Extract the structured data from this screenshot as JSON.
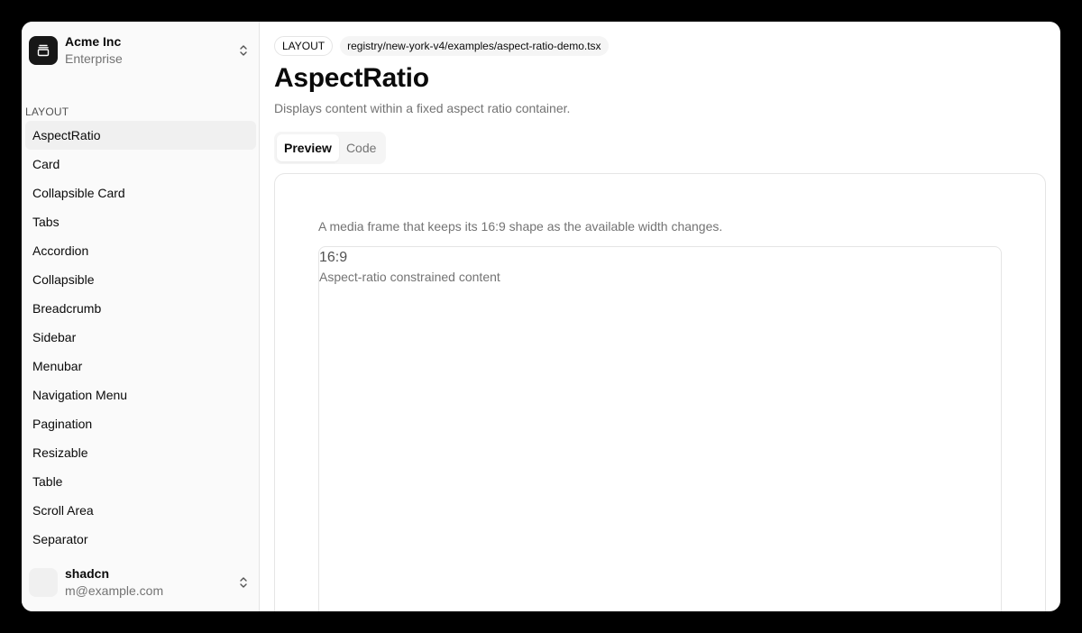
{
  "team": {
    "name": "Acme Inc",
    "plan": "Enterprise"
  },
  "sidebar": {
    "group_label": "LAYOUT",
    "items": [
      {
        "label": "AspectRatio",
        "active": true
      },
      {
        "label": "Card"
      },
      {
        "label": "Collapsible Card"
      },
      {
        "label": "Tabs"
      },
      {
        "label": "Accordion"
      },
      {
        "label": "Collapsible"
      },
      {
        "label": "Breadcrumb"
      },
      {
        "label": "Sidebar"
      },
      {
        "label": "Menubar"
      },
      {
        "label": "Navigation Menu"
      },
      {
        "label": "Pagination"
      },
      {
        "label": "Resizable"
      },
      {
        "label": "Table"
      },
      {
        "label": "Scroll Area"
      },
      {
        "label": "Separator"
      }
    ]
  },
  "user": {
    "name": "shadcn",
    "email": "m@example.com"
  },
  "main": {
    "category_badge": "LAYOUT",
    "path_badge": "registry/new-york-v4/examples/aspect-ratio-demo.tsx",
    "title": "AspectRatio",
    "description": "Displays content within a fixed aspect ratio container.",
    "tabs": [
      {
        "label": "Preview",
        "active": true
      },
      {
        "label": "Code"
      }
    ],
    "preview": {
      "caption": "A media frame that keeps its 16:9 shape as the available width changes.",
      "ratio_label": "16:9",
      "ratio_text": "Aspect-ratio constrained content"
    }
  },
  "icons": {
    "team_logo": "gallery-vertical-end-icon",
    "team_chevron": "chevrons-up-down-icon",
    "user_chevron": "chevrons-up-down-icon"
  },
  "colors": {
    "sidebar_bg": "#fafafa",
    "logo_bg": "#171717",
    "muted_text": "#737373",
    "border": "#e5e5e5"
  }
}
